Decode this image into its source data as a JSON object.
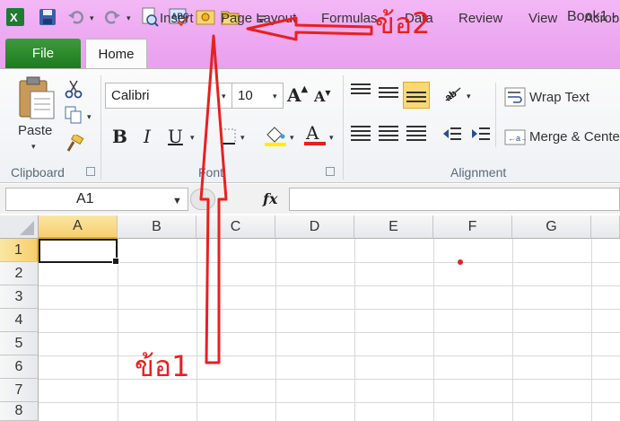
{
  "window": {
    "title": "Book1 -"
  },
  "annotations": {
    "label_top": "ข้อ2",
    "label_bottom": "ข้อ1",
    "color": "#e8201f"
  },
  "qat": {
    "icons": [
      "excel-icon",
      "save-icon",
      "undo-icon",
      "redo-icon",
      "print-preview-icon",
      "spelling-icon",
      "new-icon",
      "open-icon",
      "customize-icon"
    ]
  },
  "tabs": [
    "File",
    "Home",
    "Insert",
    "Page Layout",
    "Formulas",
    "Data",
    "Review",
    "View",
    "Acrob"
  ],
  "ribbon": {
    "clipboard": {
      "paste_label": "Paste",
      "group_label": "Clipboard"
    },
    "font": {
      "font_name": "Calibri",
      "font_size": "10",
      "group_label": "Font"
    },
    "alignment": {
      "wrap_text": "Wrap Text",
      "merge_center": "Merge & Cente",
      "group_label": "Alignment"
    }
  },
  "formula_bar": {
    "name_box": "A1",
    "fx_label": "fx",
    "value": ""
  },
  "grid": {
    "columns": [
      "A",
      "B",
      "C",
      "D",
      "E",
      "F",
      "G"
    ],
    "rows": [
      "1",
      "2",
      "3",
      "4",
      "5",
      "6",
      "7",
      "8"
    ],
    "active_cell": "A1"
  },
  "colors": {
    "title_bar": "#eda9f1",
    "file_tab": "#2e8b2e",
    "active_header": "#f7cf6b",
    "annotation_red": "#e8201f"
  }
}
